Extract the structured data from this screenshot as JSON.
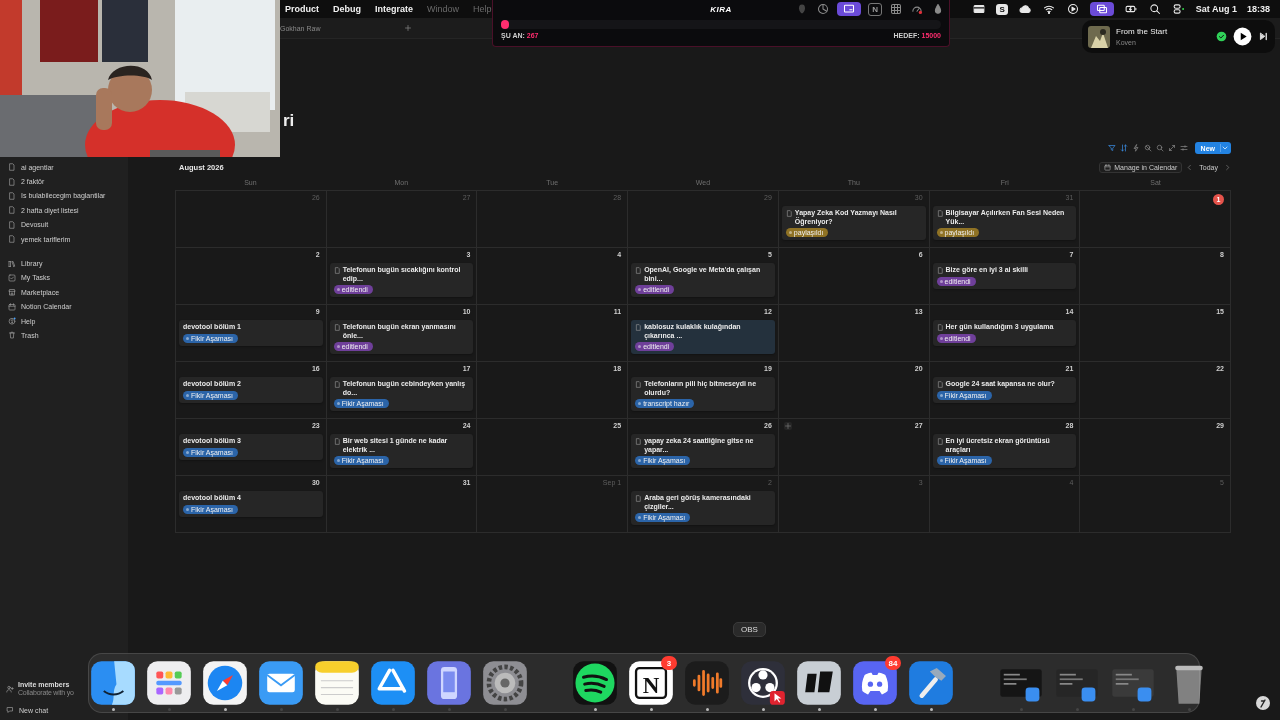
{
  "menubar": {
    "menus": [
      {
        "label": "Product",
        "disabled": false
      },
      {
        "label": "Debug",
        "disabled": false
      },
      {
        "label": "Integrate",
        "disabled": false
      },
      {
        "label": "Window",
        "disabled": true
      },
      {
        "label": "Help",
        "disabled": true
      }
    ],
    "status_icons": [
      {
        "kind": "card",
        "selected": false
      },
      {
        "kind": "letter",
        "label": "S",
        "selected": false
      },
      {
        "kind": "cloud",
        "selected": false
      },
      {
        "kind": "wifi",
        "selected": false
      },
      {
        "kind": "play-circle",
        "selected": false
      },
      {
        "kind": "screens",
        "selected": true
      },
      {
        "kind": "battery",
        "selected": false
      },
      {
        "kind": "search",
        "selected": false
      },
      {
        "kind": "toggles",
        "selected": false
      }
    ],
    "date": "Sat Aug 1",
    "time": "18:38"
  },
  "kira": {
    "title": "KIRA",
    "header_icons": [
      {
        "kind": "blob",
        "selected": false
      },
      {
        "kind": "pie",
        "selected": false
      },
      {
        "kind": "screen",
        "selected": true
      },
      {
        "kind": "letter",
        "label": "N",
        "selected": false
      },
      {
        "kind": "grid",
        "selected": false
      },
      {
        "kind": "gauge",
        "selected": false
      },
      {
        "kind": "drop",
        "selected": false
      }
    ],
    "level": 0.018,
    "current_label": "ŞU AN:",
    "current_value": "267",
    "target_label": "HEDEF:",
    "target_value": "15000"
  },
  "now_playing": {
    "title": "From the Start",
    "artist": "Koven"
  },
  "tab": {
    "title": "Gokhan Raw"
  },
  "partial_heading": "ri",
  "sidebar": {
    "pages": [
      "ai agentlar",
      "2 faktör",
      "Is bulabilecegim baglantilar",
      "2 hafta diyet listesi",
      "Devosuit",
      "yemek tariflerim"
    ],
    "nav": [
      {
        "kind": "library",
        "label": "Library"
      },
      {
        "kind": "tasks",
        "label": "My Tasks"
      },
      {
        "kind": "marketplace",
        "label": "Marketplace"
      },
      {
        "kind": "calendar",
        "label": "Notion Calendar"
      },
      {
        "kind": "help",
        "label": "Help"
      },
      {
        "kind": "trash",
        "label": "Trash"
      }
    ],
    "invite": {
      "title": "Invite members",
      "subtitle": "Collaborate with yo"
    },
    "new_chat": "New chat"
  },
  "calendar": {
    "month": "August 2026",
    "new_button": "New",
    "manage_button": "Manage in Calendar",
    "today_button": "Today",
    "weekdays": [
      "Sun",
      "Mon",
      "Tue",
      "Wed",
      "Thu",
      "Fri",
      "Sat"
    ],
    "weeks": [
      [
        {
          "day": "26",
          "in_month": false,
          "today": false,
          "hovered": false
        },
        {
          "day": "27",
          "in_month": false,
          "today": false,
          "hovered": false
        },
        {
          "day": "28",
          "in_month": false,
          "today": false,
          "hovered": false
        },
        {
          "day": "29",
          "in_month": false,
          "today": false,
          "hovered": false
        },
        {
          "day": "30",
          "in_month": false,
          "today": false,
          "hovered": false,
          "events": [
            {
              "kind": "page",
              "title": "Yapay Zeka Kod Yazmayı Nasıl Öğreniyor?",
              "tag": {
                "label": "paylaşıldı",
                "color": "#8f7224"
              },
              "selected": false
            }
          ]
        },
        {
          "day": "31",
          "in_month": false,
          "today": false,
          "hovered": false,
          "events": [
            {
              "kind": "page",
              "title": "Bilgisayar Açılırken Fan Sesi Neden Yük...",
              "tag": {
                "label": "paylaşıldı",
                "color": "#8f7224"
              },
              "selected": false
            }
          ]
        },
        {
          "day": "1",
          "in_month": true,
          "today": true,
          "hovered": false
        }
      ],
      [
        {
          "day": "2",
          "in_month": true,
          "today": false,
          "hovered": false
        },
        {
          "day": "3",
          "in_month": true,
          "today": false,
          "hovered": false,
          "events": [
            {
              "kind": "page",
              "title": "Telefonun bugün sıcaklığını kontrol edip...",
              "tag": {
                "label": "editlendi",
                "color": "#6f3f9a"
              },
              "selected": false
            }
          ]
        },
        {
          "day": "4",
          "in_month": true,
          "today": false,
          "hovered": false
        },
        {
          "day": "5",
          "in_month": true,
          "today": false,
          "hovered": false,
          "events": [
            {
              "kind": "page",
              "title": "OpenAI, Google ve Meta'da çalışan bini...",
              "tag": {
                "label": "editlendi",
                "color": "#6f3f9a"
              },
              "selected": false
            }
          ]
        },
        {
          "day": "6",
          "in_month": true,
          "today": false,
          "hovered": false
        },
        {
          "day": "7",
          "in_month": true,
          "today": false,
          "hovered": false,
          "events": [
            {
              "kind": "page",
              "title": "Bize göre en iyi 3 ai skilli",
              "tag": {
                "label": "editlendi",
                "color": "#6f3f9a"
              },
              "selected": false
            }
          ]
        },
        {
          "day": "8",
          "in_month": true,
          "today": false,
          "hovered": false
        }
      ],
      [
        {
          "day": "9",
          "in_month": true,
          "today": false,
          "hovered": false,
          "events": [
            {
              "kind": "plain",
              "title": "devotool bölüm 1",
              "tag": {
                "label": "Fikir Aşaması",
                "color": "#2b64a8"
              },
              "selected": false
            }
          ]
        },
        {
          "day": "10",
          "in_month": true,
          "today": false,
          "hovered": false,
          "events": [
            {
              "kind": "page",
              "title": "Telefonun bugün ekran yanmasını önle...",
              "tag": {
                "label": "editlendi",
                "color": "#6f3f9a"
              },
              "selected": false
            }
          ]
        },
        {
          "day": "11",
          "in_month": true,
          "today": false,
          "hovered": false
        },
        {
          "day": "12",
          "in_month": true,
          "today": false,
          "hovered": false,
          "events": [
            {
              "kind": "page",
              "title": "kablosuz kulaklık kulağından çıkarınca ...",
              "tag": {
                "label": "editlendi",
                "color": "#6f3f9a"
              },
              "selected": true
            }
          ]
        },
        {
          "day": "13",
          "in_month": true,
          "today": false,
          "hovered": false
        },
        {
          "day": "14",
          "in_month": true,
          "today": false,
          "hovered": false,
          "events": [
            {
              "kind": "page",
              "title": "Her gün kullandığım 3 uygulama",
              "tag": {
                "label": "editlendi",
                "color": "#6f3f9a"
              },
              "selected": false
            }
          ]
        },
        {
          "day": "15",
          "in_month": true,
          "today": false,
          "hovered": false
        }
      ],
      [
        {
          "day": "16",
          "in_month": true,
          "today": false,
          "hovered": false,
          "events": [
            {
              "kind": "plain",
              "title": "devotool bölüm 2",
              "tag": {
                "label": "Fikir Aşaması",
                "color": "#2b64a8"
              },
              "selected": false
            }
          ]
        },
        {
          "day": "17",
          "in_month": true,
          "today": false,
          "hovered": false,
          "events": [
            {
              "kind": "page",
              "title": "Telefonun bugün cebindeyken yanlış do...",
              "tag": {
                "label": "Fikir Aşaması",
                "color": "#2b64a8"
              },
              "selected": false
            }
          ]
        },
        {
          "day": "18",
          "in_month": true,
          "today": false,
          "hovered": false
        },
        {
          "day": "19",
          "in_month": true,
          "today": false,
          "hovered": false,
          "events": [
            {
              "kind": "page",
              "title": "Telefonların pili hiç bitmeseydi ne olurdu?",
              "tag": {
                "label": "transcript hazır",
                "color": "#2b64a8"
              },
              "selected": false
            }
          ]
        },
        {
          "day": "20",
          "in_month": true,
          "today": false,
          "hovered": false
        },
        {
          "day": "21",
          "in_month": true,
          "today": false,
          "hovered": false,
          "events": [
            {
              "kind": "page",
              "title": "Google 24 saat kapansa ne olur?",
              "tag": {
                "label": "Fikir Aşaması",
                "color": "#2b64a8"
              },
              "selected": false
            }
          ]
        },
        {
          "day": "22",
          "in_month": true,
          "today": false,
          "hovered": false
        }
      ],
      [
        {
          "day": "23",
          "in_month": true,
          "today": false,
          "hovered": false,
          "events": [
            {
              "kind": "plain",
              "title": "devotool bölüm 3",
              "tag": {
                "label": "Fikir Aşaması",
                "color": "#2b64a8"
              },
              "selected": false
            }
          ]
        },
        {
          "day": "24",
          "in_month": true,
          "today": false,
          "hovered": false,
          "events": [
            {
              "kind": "page",
              "title": "Bir web sitesi 1 günde ne kadar elektrik ...",
              "tag": {
                "label": "Fikir Aşaması",
                "color": "#2b64a8"
              },
              "selected": false
            }
          ]
        },
        {
          "day": "25",
          "in_month": true,
          "today": false,
          "hovered": false
        },
        {
          "day": "26",
          "in_month": true,
          "today": false,
          "hovered": false,
          "events": [
            {
              "kind": "page",
              "title": "yapay zeka 24 saatliğine gitse ne yapar...",
              "tag": {
                "label": "Fikir Aşaması",
                "color": "#2b64a8"
              },
              "selected": false
            }
          ]
        },
        {
          "day": "27",
          "in_month": true,
          "today": false,
          "hovered": true
        },
        {
          "day": "28",
          "in_month": true,
          "today": false,
          "hovered": false,
          "events": [
            {
              "kind": "page",
              "title": "En iyi ücretsiz ekran görüntüsü araçları",
              "tag": {
                "label": "Fikir Aşaması",
                "color": "#2b64a8"
              },
              "selected": false
            }
          ]
        },
        {
          "day": "29",
          "in_month": true,
          "today": false,
          "hovered": false
        }
      ],
      [
        {
          "day": "30",
          "in_month": true,
          "today": false,
          "hovered": false,
          "events": [
            {
              "kind": "plain",
              "title": "devotool bölüm 4",
              "tag": {
                "label": "Fikir Aşaması",
                "color": "#2b64a8"
              },
              "selected": false
            }
          ]
        },
        {
          "day": "31",
          "in_month": true,
          "today": false,
          "hovered": false
        },
        {
          "day": "Sep 1",
          "in_month": false,
          "today": false,
          "hovered": false
        },
        {
          "day": "2",
          "in_month": false,
          "today": false,
          "hovered": false,
          "events": [
            {
              "kind": "page",
              "title": "Araba geri görüş kamerasındaki çizgiler...",
              "tag": {
                "label": "Fikir Aşaması",
                "color": "#2b64a8"
              },
              "selected": false
            }
          ]
        },
        {
          "day": "3",
          "in_month": false,
          "today": false,
          "hovered": false
        },
        {
          "day": "4",
          "in_month": false,
          "today": false,
          "hovered": false
        },
        {
          "day": "5",
          "in_month": false,
          "today": false,
          "hovered": false
        }
      ]
    ]
  },
  "dock": {
    "tooltip": "OBS",
    "groups": [
      [
        {
          "kind": "finder",
          "running": true
        },
        {
          "kind": "launchpad",
          "running": false
        },
        {
          "kind": "safari",
          "running": true
        },
        {
          "kind": "mail",
          "running": false
        },
        {
          "kind": "notes",
          "running": false
        },
        {
          "kind": "appstore",
          "running": false
        },
        {
          "kind": "simulator",
          "running": false
        },
        {
          "kind": "settings",
          "running": false
        }
      ],
      [
        {
          "kind": "spotify",
          "running": true
        },
        {
          "kind": "notion",
          "label": "N",
          "badge": "3",
          "running": true
        },
        {
          "kind": "audio",
          "running": true
        },
        {
          "kind": "obs",
          "running": true
        },
        {
          "kind": "tablet",
          "running": true
        },
        {
          "kind": "discord",
          "badge": "84",
          "running": true
        },
        {
          "kind": "xcode",
          "running": true
        }
      ],
      [
        {
          "kind": "thumb-code",
          "running": false
        },
        {
          "kind": "thumb-dark",
          "running": false
        },
        {
          "kind": "thumb-light",
          "running": false
        },
        {
          "kind": "trash",
          "running": false
        }
      ]
    ]
  }
}
